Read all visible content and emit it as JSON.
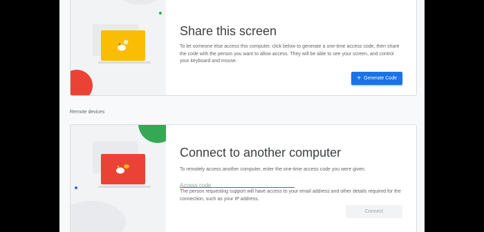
{
  "share": {
    "title": "Share this screen",
    "description": "To let someone else access this computer, click below to generate a one-time access code, then share the code with the person you want to allow access. They will be able to see your screen, and control your keyboard and mouse.",
    "button_label": "Generate Code",
    "button_icon": "+"
  },
  "remote_devices_label": "Remote devices",
  "connect": {
    "title": "Connect to another computer",
    "description": "To remotely access another computer, enter the one-time access code you were given.",
    "input_placeholder": "Access code",
    "input_value": "",
    "notice": "The person requesting support will have access to your email address and other details required for the connection, such as your IP address.",
    "button_label": "Connect"
  },
  "colors": {
    "accent": "#1a73e8",
    "share_screen": "#fbbc04",
    "connect_screen": "#ea4335",
    "green_blob": "#34a853",
    "red_blob": "#ea4335"
  }
}
